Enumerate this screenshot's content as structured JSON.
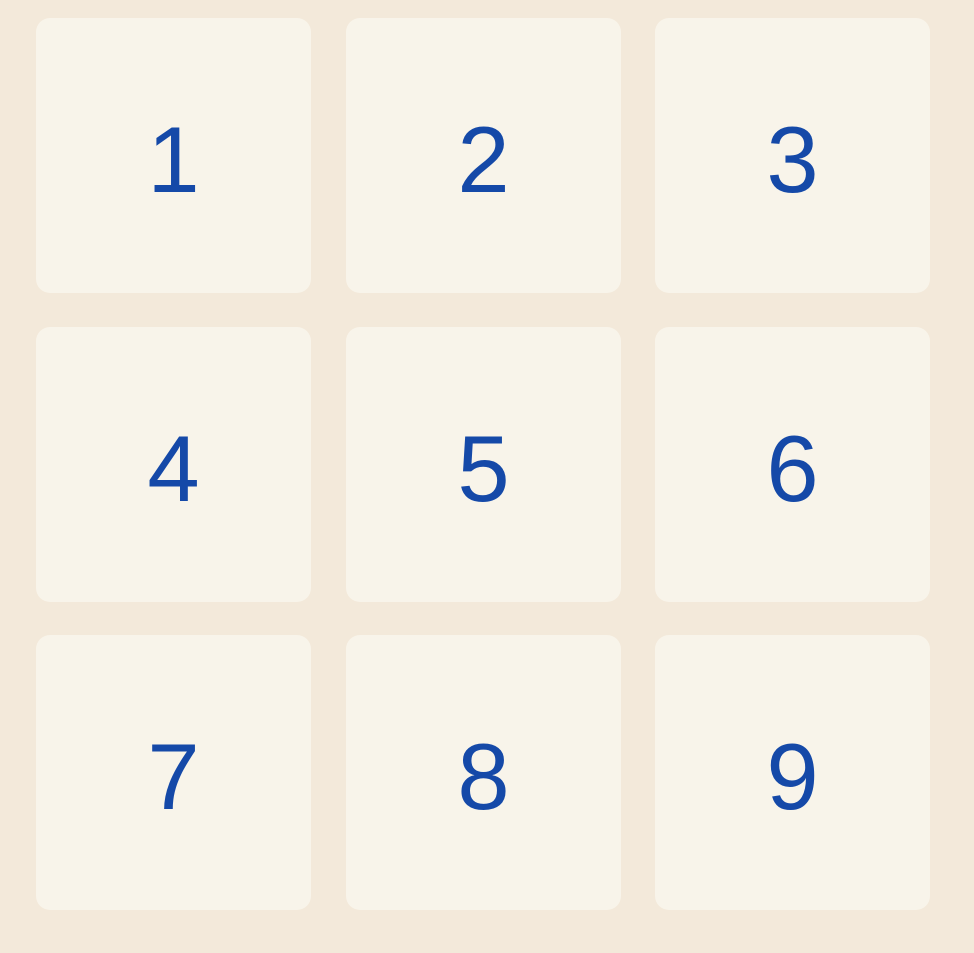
{
  "keypad": {
    "keys": [
      {
        "label": "1"
      },
      {
        "label": "2"
      },
      {
        "label": "3"
      },
      {
        "label": "4"
      },
      {
        "label": "5"
      },
      {
        "label": "6"
      },
      {
        "label": "7"
      },
      {
        "label": "8"
      },
      {
        "label": "9"
      }
    ]
  },
  "colors": {
    "background": "#f3e9da",
    "key_background": "#f8f4ea",
    "digit": "#1549a8"
  }
}
